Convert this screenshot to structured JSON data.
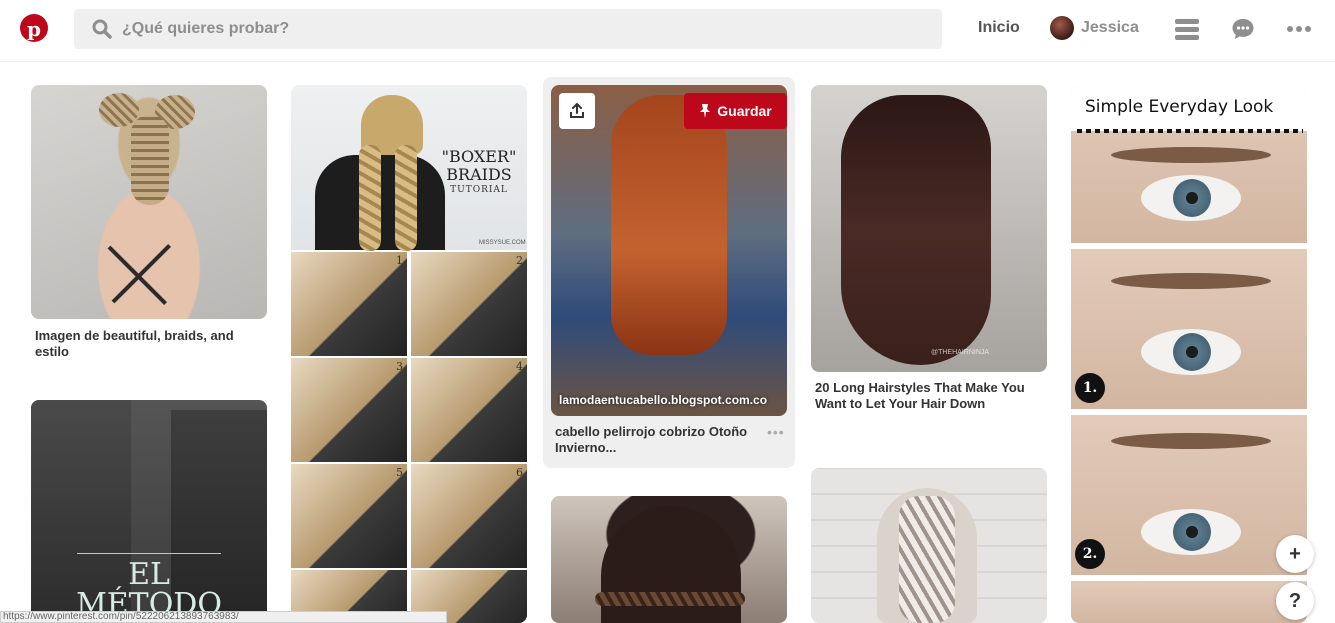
{
  "app": {
    "name": "Pinterest",
    "logo_letter": "p",
    "brand_color": "#bd081c"
  },
  "header": {
    "search_placeholder": "¿Qué quieres probar?",
    "nav_home": "Inicio",
    "user_name": "Jessica"
  },
  "pins": [
    {
      "title": "Imagen de beautiful, braids, and estilo"
    },
    {
      "image_text_line1": "\"BOXER\"",
      "image_text_line2": "BRAIDS",
      "image_text_line3": "TUTORIAL",
      "watermark": "MISSYSUE.COM",
      "steps": [
        "1",
        "2",
        "3",
        "4",
        "5",
        "6",
        "7",
        "8"
      ]
    },
    {
      "title": "cabello pelirrojo cobrizo Otoño Invierno...",
      "image_caption": "lamodaentucabello.blogspot.com.co",
      "save_label": "Guardar",
      "more": "•••"
    },
    {
      "title": "20 Long Hairstyles That Make You Want to Let Your Hair Down",
      "watermark": "@THEHAIRNINJA"
    },
    {
      "image_title": "Simple Everyday Look",
      "steps": [
        "1.",
        "2."
      ]
    },
    {
      "image_text_line1": "EL",
      "image_text_line2": "MÉTODO"
    }
  ],
  "floating": {
    "add_label": "+",
    "help_label": "?"
  },
  "status_bar": {
    "url": "https://www.pinterest.com/pin/522206213893763983/"
  }
}
